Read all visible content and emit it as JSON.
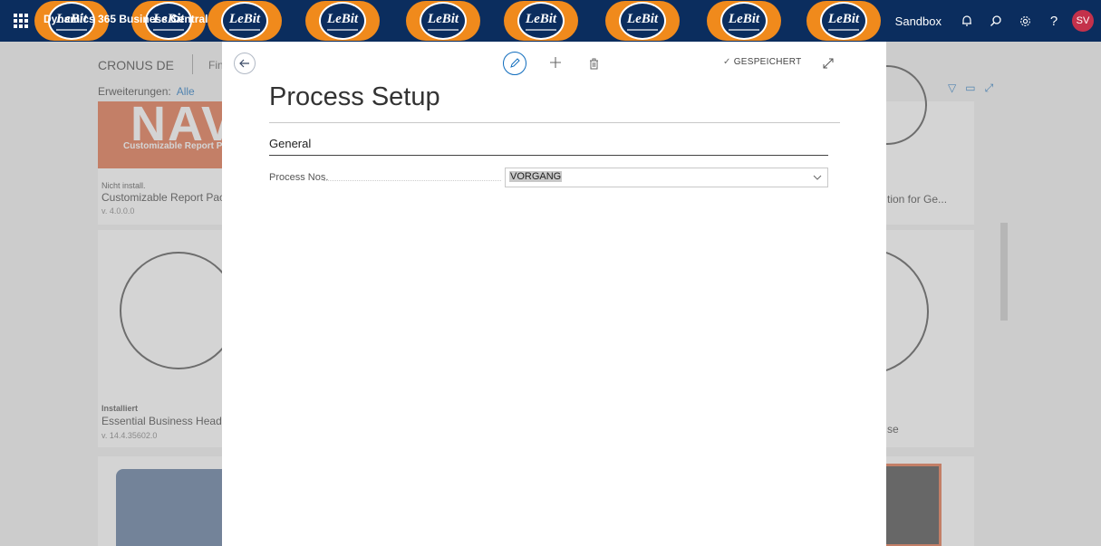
{
  "topbar": {
    "app_name": "Dynamics 365 Business Central",
    "logo_text": "LeBit",
    "logo_count": 9,
    "environment": "Sandbox",
    "avatar_initials": "SV",
    "icons": [
      "waffle-icon",
      "bell-icon",
      "search-icon",
      "gear-icon",
      "help-icon"
    ]
  },
  "background": {
    "company": "CRONUS DE",
    "page_partial": "Fin",
    "filter_label": "Erweiterungen:",
    "filter_value": "Alle",
    "tiles": [
      {
        "logo_text": "NAV",
        "logo_subtitle": "Customizable Report P",
        "status": "Nicht install.",
        "name": "Customizable Report Pac",
        "version": "v. 4.0.0.0"
      },
      {
        "status": "Installiert",
        "name": "Essential Business Headli",
        "version": "v. 14.4.35602.0"
      }
    ],
    "right_partial_1": "tion for Ge...",
    "right_partial_2": "se"
  },
  "dialog": {
    "saved_status": "GESPEICHERT",
    "title": "Process Setup",
    "section": "General",
    "fields": [
      {
        "label": "Process Nos.",
        "value": "VORGANG"
      }
    ]
  },
  "colors": {
    "topbar": "#0b2d5e",
    "logo_orange": "#f08a1c",
    "accent": "#0f6cbd",
    "avatar": "#c4314b"
  }
}
